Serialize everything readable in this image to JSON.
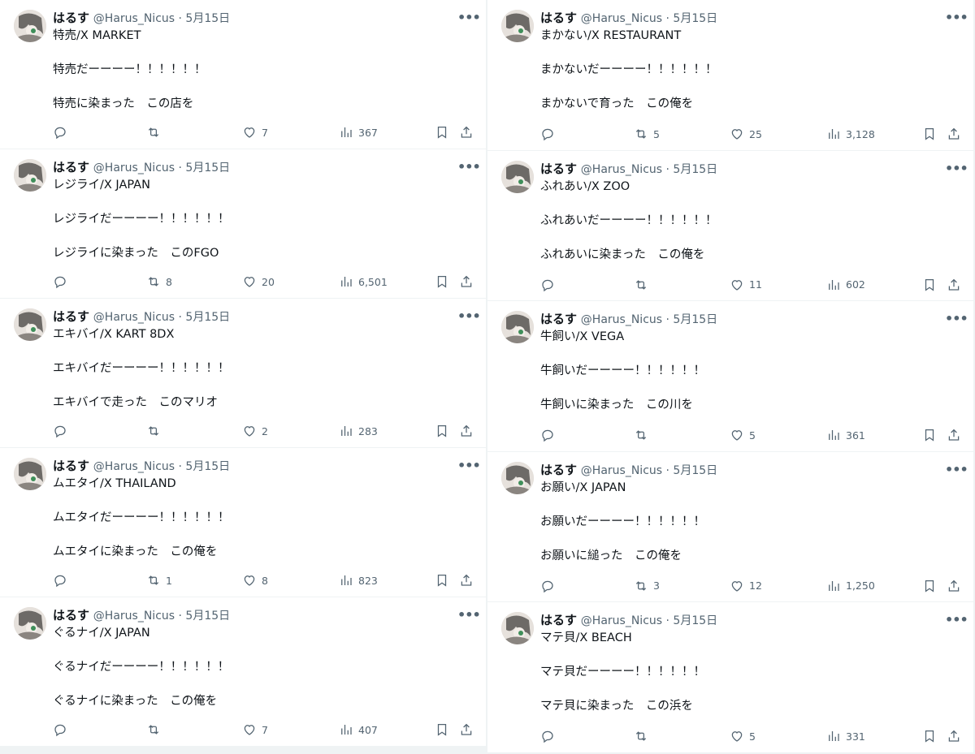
{
  "left": [
    {
      "name": "はるす",
      "handle": "@Harus_Nicus",
      "date": "5月15日",
      "title": "特売/X MARKET",
      "line1": "特売だーーーー！！！！！！",
      "line2": "特売に染まった　この店を",
      "retweets": "",
      "likes": "7",
      "views": "367"
    },
    {
      "name": "はるす",
      "handle": "@Harus_Nicus",
      "date": "5月15日",
      "title": "レジライ/X JAPAN",
      "line1": "レジライだーーーー！！！！！！",
      "line2": "レジライに染まった　このFGO",
      "retweets": "8",
      "likes": "20",
      "views": "6,501"
    },
    {
      "name": "はるす",
      "handle": "@Harus_Nicus",
      "date": "5月15日",
      "title": "エキバイ/X KART 8DX",
      "line1": "エキバイだーーーー！！！！！！",
      "line2": "エキバイで走った　このマリオ",
      "retweets": "",
      "likes": "2",
      "views": "283"
    },
    {
      "name": "はるす",
      "handle": "@Harus_Nicus",
      "date": "5月15日",
      "title": "ムエタイ/X THAILAND",
      "line1": "ムエタイだーーーー！！！！！！",
      "line2": "ムエタイに染まった　この俺を",
      "retweets": "1",
      "likes": "8",
      "views": "823"
    },
    {
      "name": "はるす",
      "handle": "@Harus_Nicus",
      "date": "5月15日",
      "title": "ぐるナイ/X JAPAN",
      "line1": "ぐるナイだーーーー！！！！！！",
      "line2": "ぐるナイに染まった　この俺を",
      "retweets": "",
      "likes": "7",
      "views": "407"
    }
  ],
  "right": [
    {
      "name": "はるす",
      "handle": "@Harus_Nicus",
      "date": "5月15日",
      "title": "まかない/X RESTAURANT",
      "line1": "まかないだーーーー！！！！！！",
      "line2": "まかないで育った　この俺を",
      "retweets": "5",
      "likes": "25",
      "views": "3,128"
    },
    {
      "name": "はるす",
      "handle": "@Harus_Nicus",
      "date": "5月15日",
      "title": "ふれあい/X ZOO",
      "line1": "ふれあいだーーーー！！！！！！",
      "line2": "ふれあいに染まった　この俺を",
      "retweets": "",
      "likes": "11",
      "views": "602"
    },
    {
      "name": "はるす",
      "handle": "@Harus_Nicus",
      "date": "5月15日",
      "title": "牛飼い/X VEGA",
      "line1": "牛飼いだーーーー！！！！！！",
      "line2": "牛飼いに染まった　この川を",
      "retweets": "",
      "likes": "5",
      "views": "361"
    },
    {
      "name": "はるす",
      "handle": "@Harus_Nicus",
      "date": "5月15日",
      "title": "お願い/X JAPAN",
      "line1": "お願いだーーーー！！！！！！",
      "line2": "お願いに縋った　この俺を",
      "retweets": "3",
      "likes": "12",
      "views": "1,250"
    },
    {
      "name": "はるす",
      "handle": "@Harus_Nicus",
      "date": "5月15日",
      "title": "マテ貝/X BEACH",
      "line1": "マテ貝だーーーー！！！！！！",
      "line2": "マテ貝に染まった　この浜を",
      "retweets": "",
      "likes": "5",
      "views": "331"
    }
  ],
  "separator": " · ",
  "icons": [
    "reply-icon",
    "retweet-icon",
    "like-icon",
    "views-icon",
    "bookmark-icon",
    "share-icon",
    "more-icon"
  ]
}
